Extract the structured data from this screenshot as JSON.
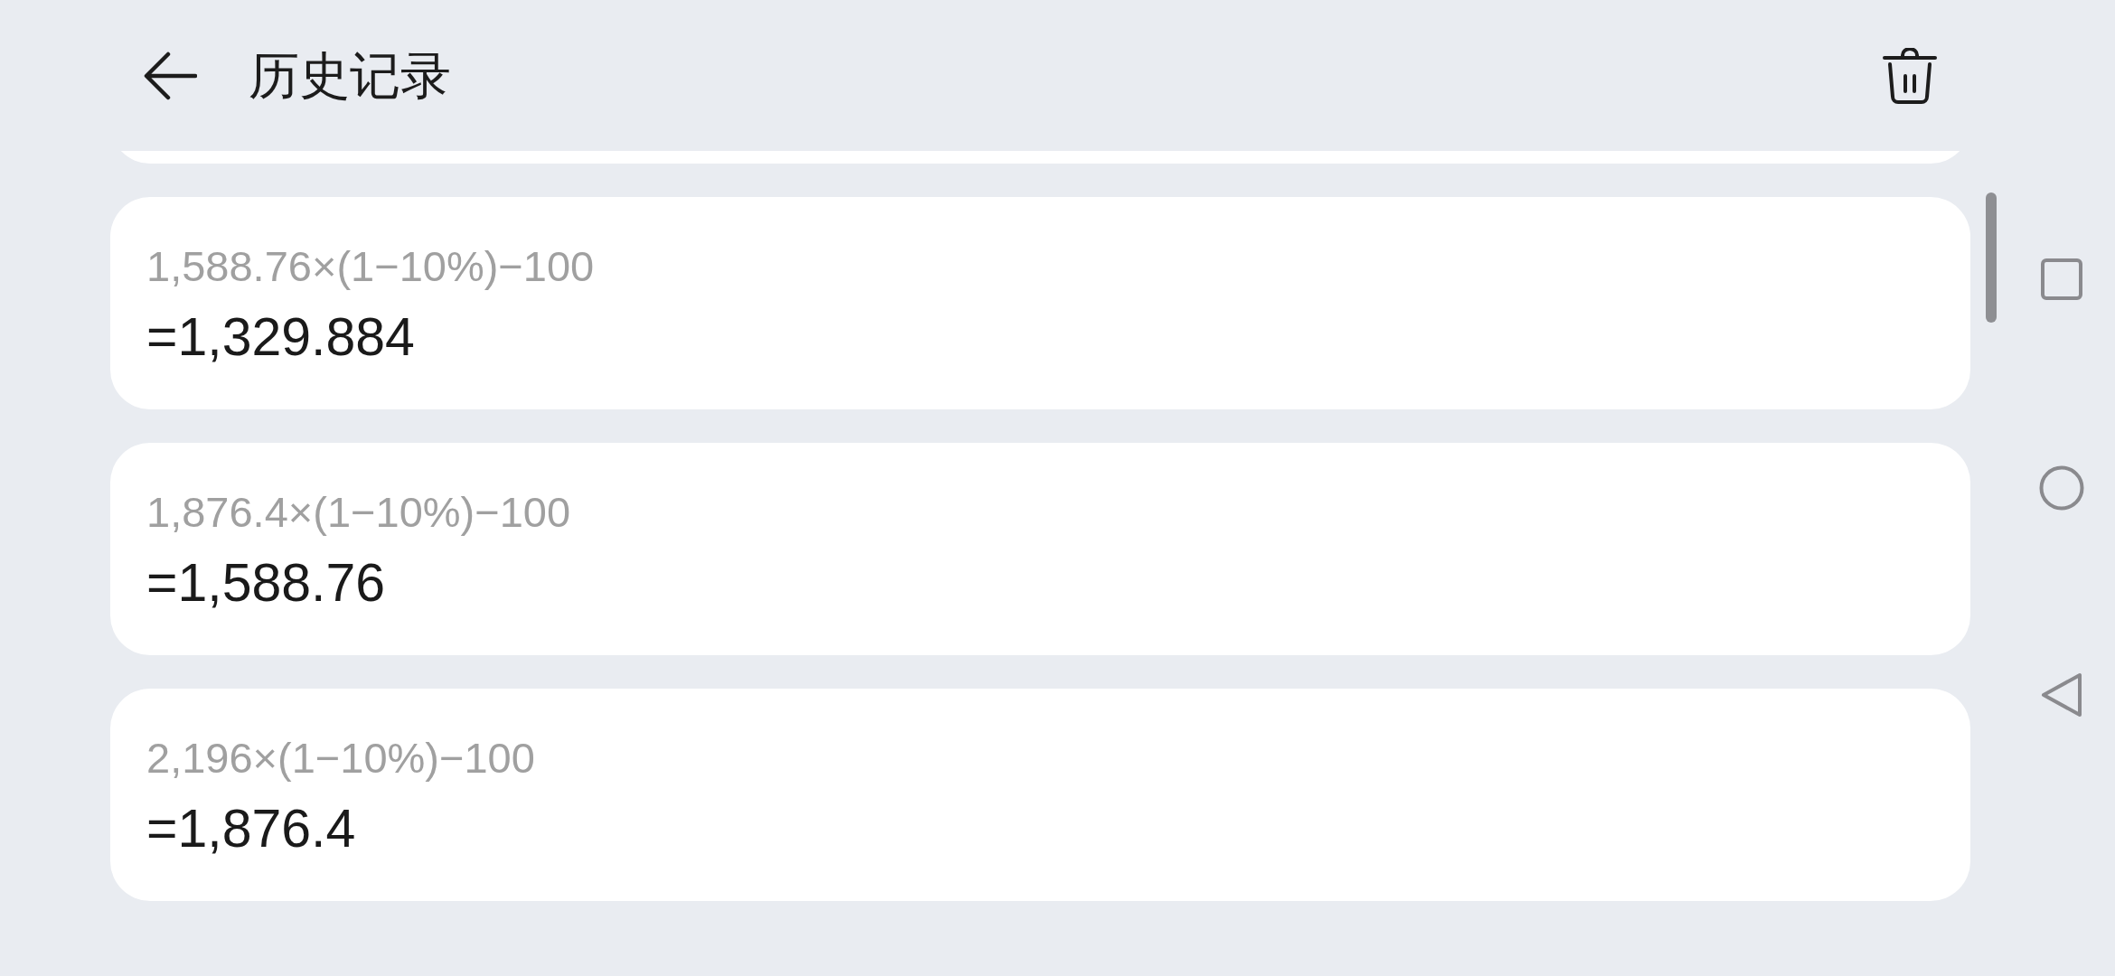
{
  "header": {
    "title": "历史记录"
  },
  "history": [
    {
      "expression": "1,588.76×(1−10%)−100",
      "result": "=1,329.884"
    },
    {
      "expression": "1,876.4×(1−10%)−100",
      "result": "=1,588.76"
    },
    {
      "expression": "2,196×(1−10%)−100",
      "result": "=1,876.4"
    }
  ]
}
